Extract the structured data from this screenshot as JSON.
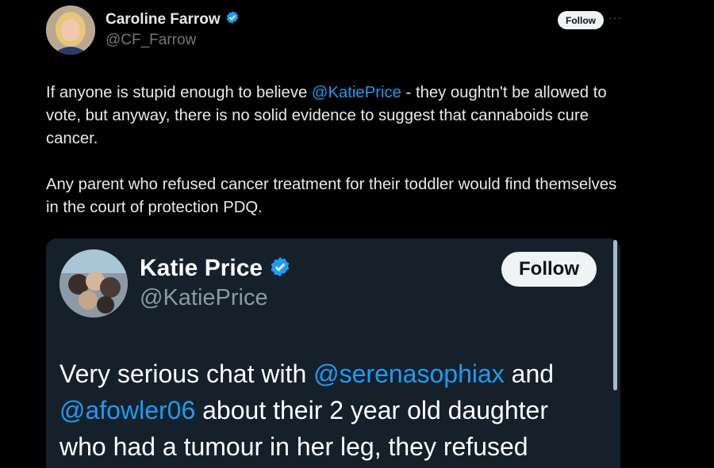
{
  "author": {
    "name": "Caroline Farrow",
    "handle": "@CF_Farrow",
    "follow_label": "Follow",
    "more_icon": "more-horizontal-icon"
  },
  "tweet": {
    "paragraph1_before": "If anyone is stupid enough to believe ",
    "paragraph1_mention": "@KatiePrice",
    "paragraph1_after": " - they oughtn't be allowed to vote, but anyway, there is no solid evidence to suggest that cannaboids cure cancer.",
    "paragraph2": "Any parent who refused cancer treatment for their toddler would find themselves in the court of protection PDQ."
  },
  "quoted": {
    "name": "Katie Price",
    "handle": "@KatiePrice",
    "follow_label": "Follow",
    "text_1": "Very serious chat with ",
    "mention_1": "@serenasophiax",
    "text_2": " and ",
    "mention_2": "@afowler06",
    "text_3": " about their 2 year old daughter who had a tumour in her leg, they refused"
  },
  "colors": {
    "accent": "#1d9bf0",
    "background": "#000000",
    "card_background": "#15202b"
  }
}
